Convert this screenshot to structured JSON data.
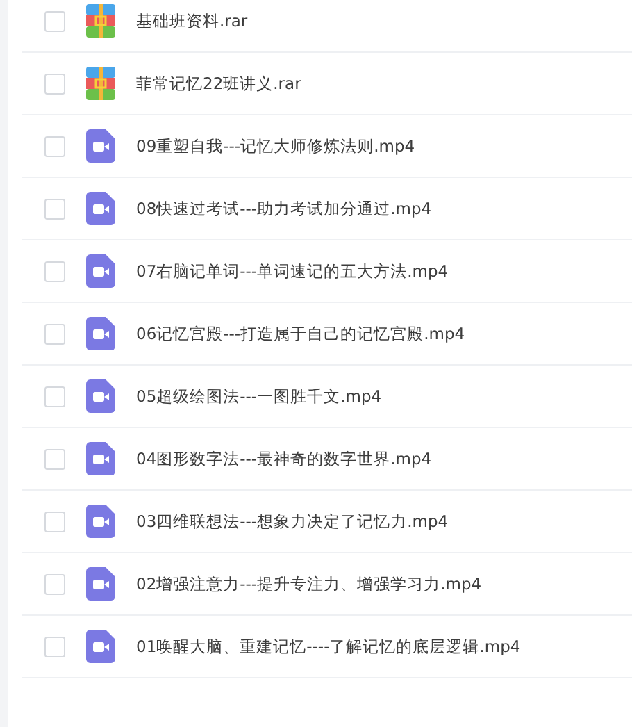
{
  "files": [
    {
      "kind": "archive",
      "name": "基础班资料.rar",
      "checked": false
    },
    {
      "kind": "archive",
      "name": "菲常记忆22班讲义.rar",
      "checked": false
    },
    {
      "kind": "video",
      "name": "09重塑自我---记忆大师修炼法则.mp4",
      "checked": false
    },
    {
      "kind": "video",
      "name": "08快速过考试---助力考试加分通过.mp4",
      "checked": false
    },
    {
      "kind": "video",
      "name": "07右脑记单词---单词速记的五大方法.mp4",
      "checked": false
    },
    {
      "kind": "video",
      "name": "06记忆宫殿---打造属于自己的记忆宫殿.mp4",
      "checked": false
    },
    {
      "kind": "video",
      "name": "05超级绘图法---一图胜千文.mp4",
      "checked": false
    },
    {
      "kind": "video",
      "name": "04图形数字法---最神奇的数字世界.mp4",
      "checked": false
    },
    {
      "kind": "video",
      "name": "03四维联想法---想象力决定了记忆力.mp4",
      "checked": false
    },
    {
      "kind": "video",
      "name": "02增强注意力---提升专注力、增强学习力.mp4",
      "checked": false
    },
    {
      "kind": "video",
      "name": "01唤醒大脑、重建记忆----了解记忆的底层逻辑.mp4",
      "checked": false
    }
  ]
}
